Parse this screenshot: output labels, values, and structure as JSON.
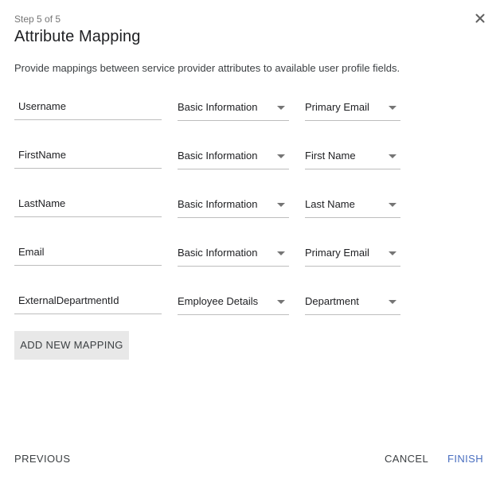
{
  "header": {
    "step": "Step 5 of 5",
    "title": "Attribute Mapping",
    "close_icon": "close-icon"
  },
  "description": "Provide mappings between service provider attributes to available user profile fields.",
  "mappings": [
    {
      "attribute": "Username",
      "category": "Basic Information",
      "field": "Primary Email"
    },
    {
      "attribute": "FirstName",
      "category": "Basic Information",
      "field": "First Name"
    },
    {
      "attribute": "LastName",
      "category": "Basic Information",
      "field": "Last Name"
    },
    {
      "attribute": "Email",
      "category": "Basic Information",
      "field": "Primary Email"
    },
    {
      "attribute": "ExternalDepartmentId",
      "category": "Employee Details",
      "field": "Department"
    }
  ],
  "actions": {
    "add_mapping": "ADD NEW MAPPING",
    "previous": "PREVIOUS",
    "cancel": "CANCEL",
    "finish": "FINISH"
  },
  "colors": {
    "accent": "#4a6fc0",
    "button_bg": "#e8e8e8",
    "underline": "#bdbdbd"
  }
}
